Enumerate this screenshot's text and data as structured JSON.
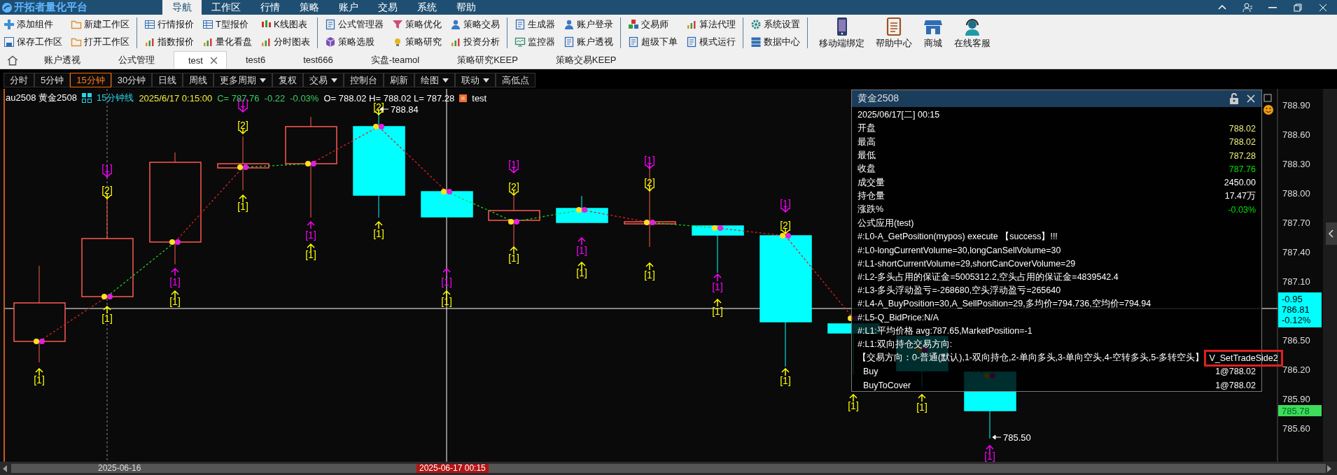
{
  "app": {
    "title": "开拓者量化平台"
  },
  "menu": [
    {
      "label": "导航",
      "selected": true
    },
    {
      "label": "工作区",
      "selected": false
    },
    {
      "label": "行情",
      "selected": false
    },
    {
      "label": "策略",
      "selected": false
    },
    {
      "label": "账户",
      "selected": false
    },
    {
      "label": "交易",
      "selected": false
    },
    {
      "label": "系统",
      "selected": false
    },
    {
      "label": "帮助",
      "selected": false
    }
  ],
  "ribbon": {
    "groups": [
      [
        [
          "添加组件",
          "保存工作区"
        ],
        [
          "新建工作区",
          "打开工作区"
        ]
      ],
      [
        [
          "行情报价",
          "指数报价"
        ],
        [
          "T型报价",
          "量化看盘"
        ],
        [
          "K线图表",
          "分时图表"
        ]
      ],
      [
        [
          "公式管理器",
          "策略选股"
        ],
        [
          "策略优化",
          "策略研究"
        ],
        [
          "策略交易",
          "投资分析"
        ]
      ],
      [
        [
          "生成器",
          "监控器"
        ],
        [
          "账户登录",
          "账户透视"
        ]
      ],
      [
        [
          "交易师",
          "超级下单"
        ],
        [
          "算法代理",
          "模式运行"
        ]
      ],
      [
        [
          "系统设置",
          "数据中心"
        ]
      ]
    ],
    "large_buttons": [
      "移动端绑定",
      "帮助中心",
      "商城",
      "在线客服"
    ]
  },
  "tabs": [
    {
      "label": "账户透视",
      "selected": false
    },
    {
      "label": "公式管理",
      "selected": false
    },
    {
      "label": "test",
      "selected": true
    },
    {
      "label": "test6",
      "selected": false
    },
    {
      "label": "test666",
      "selected": false
    },
    {
      "label": "实盘-teamol",
      "selected": false
    },
    {
      "label": "策略研究KEEP",
      "selected": false
    },
    {
      "label": "策略交易KEEP",
      "selected": false
    }
  ],
  "period_bar": [
    {
      "label": "分时",
      "selected": false,
      "dropdown": false
    },
    {
      "label": "5分钟",
      "selected": false,
      "dropdown": false
    },
    {
      "label": "15分钟",
      "selected": true,
      "dropdown": false
    },
    {
      "label": "30分钟",
      "selected": false,
      "dropdown": false
    },
    {
      "label": "日线",
      "selected": false,
      "dropdown": false
    },
    {
      "label": "周线",
      "selected": false,
      "dropdown": false
    },
    {
      "label": "更多周期",
      "selected": false,
      "dropdown": true
    },
    {
      "label": "复权",
      "selected": false,
      "dropdown": false
    },
    {
      "label": "交易",
      "selected": false,
      "dropdown": true
    },
    {
      "label": "控制台",
      "selected": false,
      "dropdown": false
    },
    {
      "label": "刷新",
      "selected": false,
      "dropdown": false
    },
    {
      "label": "绘图",
      "selected": false,
      "dropdown": true
    },
    {
      "label": "联动",
      "selected": false,
      "dropdown": true
    },
    {
      "label": "高低点",
      "selected": false,
      "dropdown": false
    }
  ],
  "chart": {
    "info": {
      "symbol": "au2508 黄金2508",
      "period": "15分钟线",
      "time": "2025/6/17 0:15:00",
      "close": "C= 787.76",
      "change": "-0.22",
      "change_pct": "-0.03%",
      "ohlc": "O= 788.02  H= 788.02  L= 787.28",
      "indicator": "test"
    },
    "high_label": "788.84",
    "low_label": "785.50",
    "markers": [
      {
        "text": "[1]",
        "kind": "up",
        "color": "#ffff00"
      },
      {
        "text": "[1]",
        "kind": "down",
        "color": "#ff00ff"
      },
      {
        "text": "[2]",
        "kind": "down",
        "color": "#ffff00"
      },
      {
        "text": "[1]",
        "kind": "up",
        "color": "#ffff00"
      },
      {
        "text": "[1]",
        "kind": "up",
        "color": "#ff00ff"
      },
      {
        "text": "[1]",
        "kind": "up",
        "color": "#ffff00"
      },
      {
        "text": "[1]",
        "kind": "down",
        "color": "#ff00ff"
      },
      {
        "text": "[2]",
        "kind": "down",
        "color": "#ffff00"
      },
      {
        "text": "[1]",
        "kind": "up",
        "color": "#ffff00"
      },
      {
        "text": "[1]",
        "kind": "up",
        "color": "#ff00ff"
      },
      {
        "text": "[1]",
        "kind": "up",
        "color": "#ffff00"
      },
      {
        "text": "[2]",
        "kind": "down",
        "color": "#ffff00"
      },
      {
        "text": "[1]",
        "kind": "up",
        "color": "#ffff00"
      },
      {
        "text": "[1]",
        "kind": "up",
        "color": "#ff00ff"
      },
      {
        "text": "[1]",
        "kind": "up",
        "color": "#ffff00"
      },
      {
        "text": "[1]",
        "kind": "down",
        "color": "#ff00ff"
      },
      {
        "text": "[2]",
        "kind": "down",
        "color": "#ffff00"
      },
      {
        "text": "[1]",
        "kind": "up",
        "color": "#ffff00"
      },
      {
        "text": "[1]",
        "kind": "up",
        "color": "#ff00ff"
      },
      {
        "text": "[1]",
        "kind": "up",
        "color": "#ffff00"
      },
      {
        "text": "[1]",
        "kind": "down",
        "color": "#ff00ff"
      },
      {
        "text": "[2]",
        "kind": "down",
        "color": "#ffff00"
      },
      {
        "text": "[1]",
        "kind": "up",
        "color": "#ffff00"
      },
      {
        "text": "[1]",
        "kind": "up",
        "color": "#ff00ff"
      },
      {
        "text": "[1]",
        "kind": "up",
        "color": "#ffff00"
      },
      {
        "text": "[1]",
        "kind": "down",
        "color": "#ff00ff"
      },
      {
        "text": "[2]",
        "kind": "down",
        "color": "#ffff00"
      },
      {
        "text": "[1]",
        "kind": "up",
        "color": "#ffff00"
      },
      {
        "text": "[1]",
        "kind": "up",
        "color": "#ffff00"
      },
      {
        "text": "[1]",
        "kind": "up",
        "color": "#ffff00"
      },
      {
        "text": "[1]",
        "kind": "up",
        "color": "#ff00ff"
      }
    ],
    "y_axis": [
      "788.90",
      "788.60",
      "788.30",
      "788.00",
      "787.70",
      "787.40",
      "787.10",
      "786.50",
      "786.20",
      "785.90",
      "785.60"
    ],
    "last_price": {
      "change": "-0.95",
      "price": "786.81",
      "pct": "-0.12%"
    },
    "close_tag": "785.78",
    "overlay_checkbox": {
      "checked": false
    },
    "dates": [
      {
        "label": "2025-06-16",
        "selected": false
      },
      {
        "label": "2025-06-17 00:15",
        "selected": true
      }
    ]
  },
  "popup": {
    "title": "黄金2508",
    "rows": [
      {
        "kind": "header",
        "label": "2025/06/17[二] 00:15"
      },
      {
        "kind": "field",
        "label": "开盘",
        "value": "788.02",
        "color": "#f0f080",
        "highlighted": false
      },
      {
        "kind": "field",
        "label": "最高",
        "value": "788.02",
        "color": "#f0f080",
        "highlighted": false
      },
      {
        "kind": "field",
        "label": "最低",
        "value": "787.28",
        "color": "#f0f080",
        "highlighted": false
      },
      {
        "kind": "field",
        "label": "收盘",
        "value": "787.76",
        "color": "#00e000",
        "highlighted": false
      },
      {
        "kind": "field",
        "label": "成交量",
        "value": "2450.00",
        "color": "#ffffff",
        "highlighted": false
      },
      {
        "kind": "field",
        "label": "持仓量",
        "value": "17.47万",
        "color": "#ffffff",
        "highlighted": false
      },
      {
        "kind": "field",
        "label": "涨跌%",
        "value": "-0.03%",
        "color": "#00e000",
        "highlighted": false
      },
      {
        "kind": "text",
        "label": "公式应用(test)"
      },
      {
        "kind": "text",
        "label": "#:L0-A_GetPosition(mypos) execute 【success】!!!"
      },
      {
        "kind": "text",
        "label": "#:L0-longCurrentVolume=30,longCanSellVolume=30"
      },
      {
        "kind": "text",
        "label": "#:L1-shortCurrentVolume=29,shortCanCoverVolume=29"
      },
      {
        "kind": "text",
        "label": "#:L2-多头占用的保证金=5005312.2,空头占用的保证金=4839542.4"
      },
      {
        "kind": "text",
        "label": "#:L3-多头浮动盈亏=-268680,空头浮动盈亏=265640"
      },
      {
        "kind": "text",
        "label": "#:L4-A_BuyPosition=30,A_SellPosition=29,多均价=794.736,空均价=794.94"
      },
      {
        "kind": "text",
        "label": "#:L5-Q_BidPrice:N/A"
      },
      {
        "kind": "text",
        "label": "#:L1:平均价格 avg:787.65,MarketPosition=-1"
      },
      {
        "kind": "text",
        "label": "#:L1:双向持仓交易方向:"
      },
      {
        "kind": "field",
        "label": "【交易方向：0-普通(默认),1-双向持仓,2-单向多头,3-单向空头,4-空转多头,5-多转空头】",
        "value": "V_SetTradeSide2",
        "color": "#ffffff",
        "highlighted": true
      },
      {
        "kind": "order",
        "label": "Buy",
        "value": "1@788.02",
        "color": "#ffffff",
        "highlighted": false
      },
      {
        "kind": "order",
        "label": "BuyToCover",
        "value": "1@788.02",
        "color": "#ffffff",
        "highlighted": false
      }
    ]
  }
}
